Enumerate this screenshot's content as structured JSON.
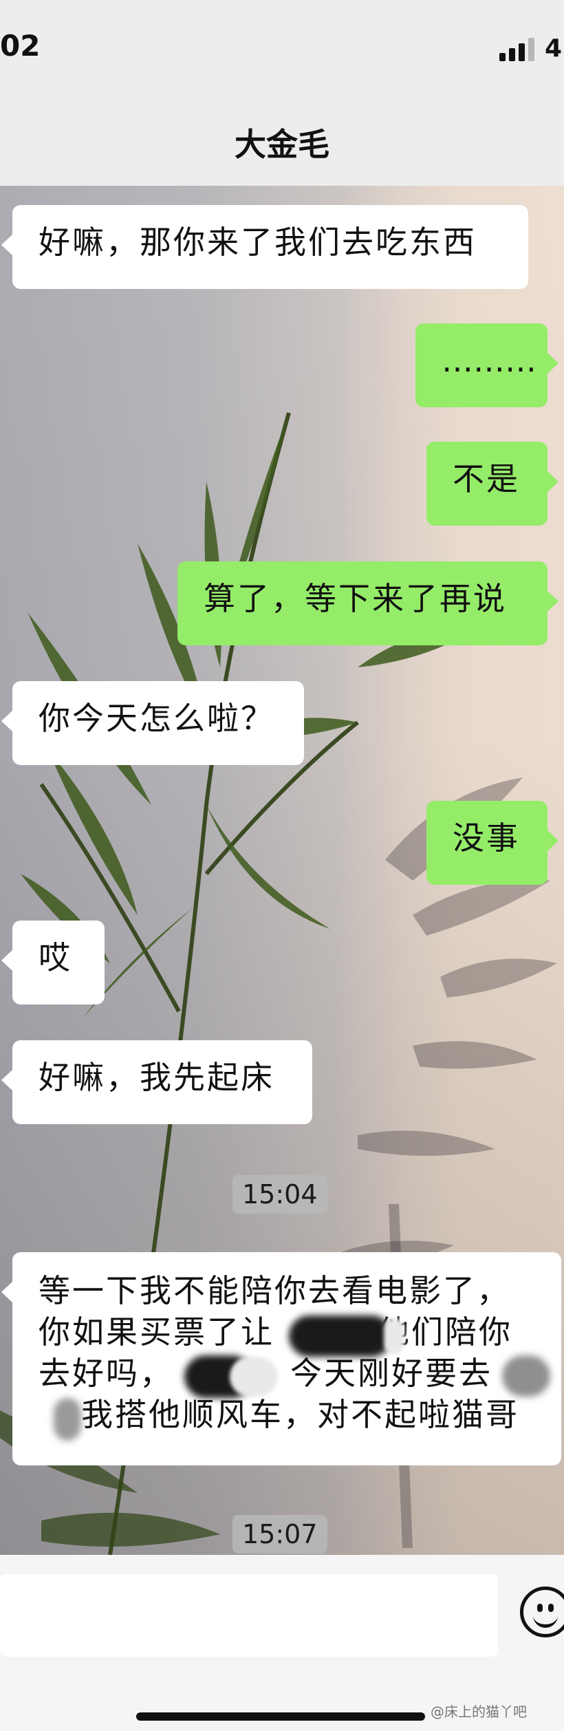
{
  "status_bar": {
    "time": "02",
    "battery_text": "4"
  },
  "header": {
    "title": "大金毛"
  },
  "messages": [
    {
      "side": "in",
      "text": "好嘛，那你来了我们去吃东西"
    },
    {
      "side": "out",
      "text": "………"
    },
    {
      "side": "out",
      "text": "不是"
    },
    {
      "side": "out",
      "text": "算了，等下来了再说"
    },
    {
      "side": "in",
      "text": "你今天怎么啦？"
    },
    {
      "side": "out",
      "text": "没事"
    },
    {
      "side": "in",
      "text": "哎"
    },
    {
      "side": "in",
      "text": "好嘛，我先起床"
    },
    {
      "side": "in",
      "lines": [
        "等一下我不能陪你去看电影了，",
        "你如果买票了让",
        "他们陪你",
        "去好吗，",
        "今天刚好要去",
        "我搭他顺风车，对不起啦猫哥"
      ]
    }
  ],
  "timestamps": [
    "15:04",
    "15:07"
  ],
  "input": {
    "placeholder": ""
  },
  "icons": {
    "emoji": "smiley-face-icon",
    "signal": "cellular-signal-icon"
  },
  "watermark": "@床上的猫丫吧",
  "colors": {
    "incoming_bubble": "#ffffff",
    "outgoing_bubble": "#95ec69",
    "header_bg": "#ededed"
  }
}
